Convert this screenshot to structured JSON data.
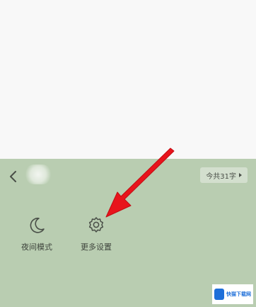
{
  "header": {
    "back_icon": "chevron-left-icon",
    "word_count_label": "今共31字"
  },
  "actions": [
    {
      "icon": "moon-icon",
      "label": "夜间模式"
    },
    {
      "icon": "gear-icon",
      "label": "更多设置"
    }
  ],
  "annotation": {
    "arrow_color": "#e8141c",
    "arrow_target": "更多设置"
  },
  "watermark": {
    "text": "快猫下载网"
  },
  "colors": {
    "panel_background": "#b9cdb1",
    "page_background": "#f8f8f8",
    "icon_color": "#4a4f48"
  }
}
